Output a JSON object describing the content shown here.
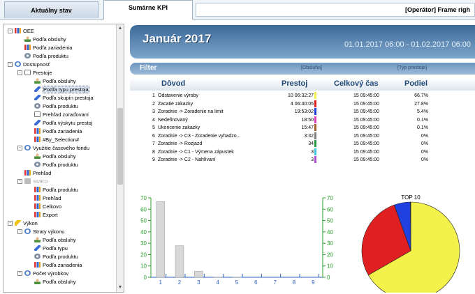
{
  "tabs": {
    "tab1": "Aktuálny stav",
    "tab2": "Sumárne KPI"
  },
  "operator": "[Operátor]  Frame righ",
  "tree": [
    {
      "label": "OEE",
      "icon": "chart",
      "level": 0,
      "toggle": "-"
    },
    {
      "label": "Podľa obsluhy",
      "icon": "person",
      "level": 1
    },
    {
      "label": "Podľa zariadenia",
      "icon": "chart",
      "level": 1
    },
    {
      "label": "Podľa produktu",
      "icon": "gear",
      "level": 1
    },
    {
      "label": "Dostupnosť",
      "icon": "clock",
      "level": 0,
      "toggle": "-"
    },
    {
      "label": "Prestoje",
      "icon": "doc",
      "level": 1,
      "toggle": "-"
    },
    {
      "label": "Podľa obsluhy",
      "icon": "person",
      "level": 2
    },
    {
      "label": "Podľa typu prestoja",
      "icon": "pencil",
      "level": 2,
      "selected": true
    },
    {
      "label": "Podľa skupín prestoja",
      "icon": "pencil",
      "level": 2
    },
    {
      "label": "Podľa produktu",
      "icon": "gear",
      "level": 2
    },
    {
      "label": "Prehľad zoraďovaní",
      "icon": "doc",
      "level": 2
    },
    {
      "label": "Podľa výskytu prestoj",
      "icon": "pencil",
      "level": 2
    },
    {
      "label": "Podľa zariadenia",
      "icon": "chart",
      "level": 2
    },
    {
      "label": "#By_Selection#",
      "icon": "chart",
      "level": 2
    },
    {
      "label": "Využitie časového fondu",
      "icon": "clock",
      "level": 1,
      "toggle": "-"
    },
    {
      "label": "Podľa obsluhy",
      "icon": "person",
      "level": 2
    },
    {
      "label": "Podľa produktu",
      "icon": "gear",
      "level": 2
    },
    {
      "label": "Prehľad",
      "icon": "chart",
      "level": 1
    },
    {
      "label": "SMED",
      "icon": "grey",
      "level": 1,
      "toggle": "-",
      "dim": true
    },
    {
      "label": "Podľa produktu",
      "icon": "chart",
      "level": 2
    },
    {
      "label": "Prehľad",
      "icon": "chart",
      "level": 2
    },
    {
      "label": "Celkovo",
      "icon": "chart",
      "level": 2
    },
    {
      "label": "Export",
      "icon": "chart",
      "level": 2
    },
    {
      "label": "Výkon",
      "icon": "bolt",
      "level": 0,
      "toggle": "-"
    },
    {
      "label": "Straty výkonu",
      "icon": "clock",
      "level": 1,
      "toggle": "-"
    },
    {
      "label": "Podľa obsluhy",
      "icon": "person",
      "level": 2
    },
    {
      "label": "Podľa typu",
      "icon": "pencil",
      "level": 2
    },
    {
      "label": "Podľa produktu",
      "icon": "gear",
      "level": 2
    },
    {
      "label": "Podľa zariadenia",
      "icon": "chart",
      "level": 2
    },
    {
      "label": "Počet výrobkov",
      "icon": "clock",
      "level": 1,
      "toggle": "-"
    },
    {
      "label": "Podľa obsluhy",
      "icon": "person",
      "level": 2
    }
  ],
  "header": {
    "title": "Január 2017",
    "range": "01.01.2017 06:00 - 01.02.2017 06:00"
  },
  "filter": {
    "label": "Filter",
    "operator": "[Obsluha]",
    "type": "[Typ prestoja]"
  },
  "table": {
    "columns": {
      "reason": "Dôvod",
      "downtime": "Prestoj",
      "total": "Celkový čas",
      "share": "Podiel"
    },
    "rows": [
      {
        "n": "1",
        "reason": "Odstavenie výroby",
        "downtime": "10 06:32:27",
        "total": "15 09:45:00",
        "share": "66.7%",
        "color": "#f2f24a"
      },
      {
        "n": "2",
        "reason": "Zacatie zakazky",
        "downtime": "4 06:40:05",
        "total": "15 09:45:00",
        "share": "27.8%",
        "color": "#e02020"
      },
      {
        "n": "3",
        "reason": "Zoradnie -> Zoradenie na limit",
        "downtime": "19:53:02",
        "total": "15 09:45:00",
        "share": "5.4%",
        "color": "#2040e0"
      },
      {
        "n": "4",
        "reason": "Nedefinovaný",
        "downtime": "18:50",
        "total": "15 09:45:00",
        "share": "0.1%",
        "color": "#e040c0"
      },
      {
        "n": "5",
        "reason": "Ukoncenie zakazky",
        "downtime": "15:47",
        "total": "15 09:45:00",
        "share": "0.1%",
        "color": "#a06030"
      },
      {
        "n": "6",
        "reason": "Zoradnie -> C3 - Zoradenie vyhadzo...",
        "downtime": "3:32",
        "total": "15 09:45:00",
        "share": "0%",
        "color": "#808080"
      },
      {
        "n": "7",
        "reason": "Zoradnie -> Rozjazd",
        "downtime": "34",
        "total": "15 09:45:00",
        "share": "0%",
        "color": "#2a9a4a"
      },
      {
        "n": "8",
        "reason": "Zoradnie -> C1 - Výmena zápustek",
        "downtime": "3",
        "total": "15 09:45:00",
        "share": "0%",
        "color": "#40c8e0"
      },
      {
        "n": "9",
        "reason": "Zoradnie -> C2 - Nahlívaní",
        "downtime": "3",
        "total": "15 09:45:00",
        "share": "0%",
        "color": "#b050d0"
      }
    ]
  },
  "chart_data": [
    {
      "type": "bar",
      "categories": [
        "1",
        "2",
        "3",
        "4",
        "5",
        "6",
        "7",
        "8",
        "9"
      ],
      "values": [
        66.7,
        27.8,
        5.4,
        0.1,
        0.1,
        0,
        0,
        0,
        0
      ],
      "yticks": [
        "0",
        "10",
        "20",
        "30",
        "40",
        "50",
        "60",
        "70"
      ],
      "ylim": [
        0,
        70
      ]
    },
    {
      "type": "pie",
      "title": "TOP 10",
      "values": [
        66.7,
        27.8,
        5.4,
        0.1
      ],
      "colors": [
        "#f2f24a",
        "#e02020",
        "#2040e0",
        "#e040c0"
      ]
    }
  ]
}
